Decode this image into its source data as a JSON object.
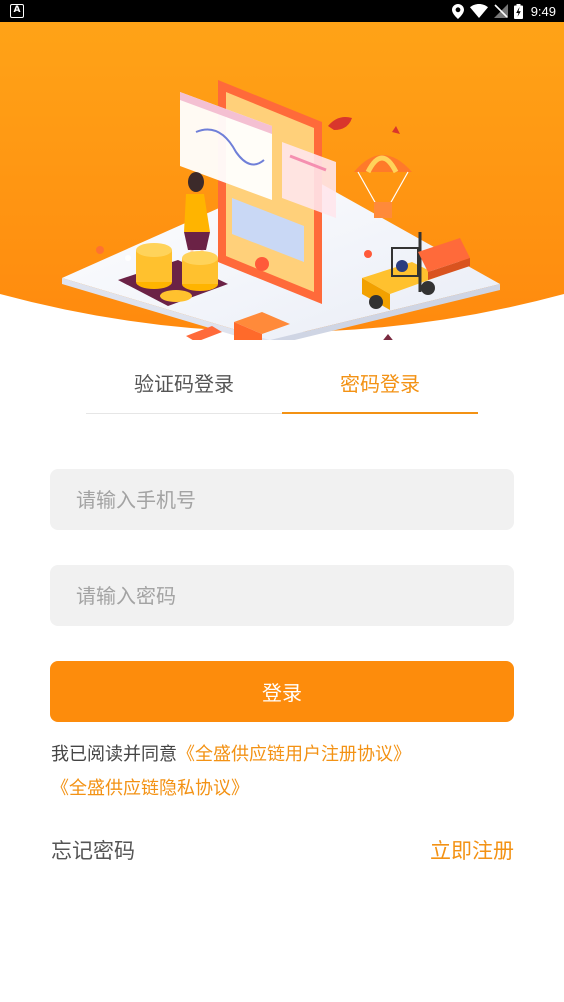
{
  "status_bar": {
    "app_icon_letter": "A",
    "time": "9:49",
    "icons": [
      "location-icon",
      "wifi-icon",
      "no-sim-icon",
      "battery-charging-icon"
    ]
  },
  "banner": {
    "illustration": "logistics-illustration",
    "colors": {
      "top": "#ffa317",
      "bottom": "#ff8a0e"
    }
  },
  "tabs": [
    {
      "label": "验证码登录",
      "active": false
    },
    {
      "label": "密码登录",
      "active": true
    }
  ],
  "form": {
    "phone_placeholder": "请输入手机号",
    "phone_value": "",
    "password_placeholder": "请输入密码",
    "password_value": "",
    "login_label": "登录"
  },
  "agreement": {
    "prefix": "我已阅读并同意",
    "user_agreement": "《全盛供应链用户注册协议》",
    "privacy_policy": "《全盛供应链隐私协议》"
  },
  "links": {
    "forgot_password": "忘记密码",
    "register_now": "立即注册"
  },
  "colors": {
    "accent": "#f39214",
    "button": "#fd8c0c",
    "input_bg": "#f1f1f1"
  }
}
